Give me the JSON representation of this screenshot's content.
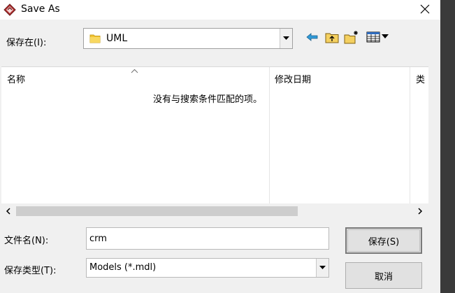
{
  "window": {
    "title": "Save As"
  },
  "save_in": {
    "label": "保存在(I):",
    "value": "UML"
  },
  "file_list": {
    "columns": [
      "名称",
      "修改日期",
      "类"
    ],
    "empty_message": "没有与搜索条件匹配的项。"
  },
  "file_name": {
    "label": "文件名(N):",
    "value": "crm"
  },
  "file_type": {
    "label": "保存类型(T):",
    "value": "Models (*.mdl)"
  },
  "buttons": {
    "save": "保存(S)",
    "cancel": "取消"
  },
  "colors": {
    "folder": "#f4c430",
    "accent": "#0078d7",
    "app_icon": "#b03030"
  }
}
